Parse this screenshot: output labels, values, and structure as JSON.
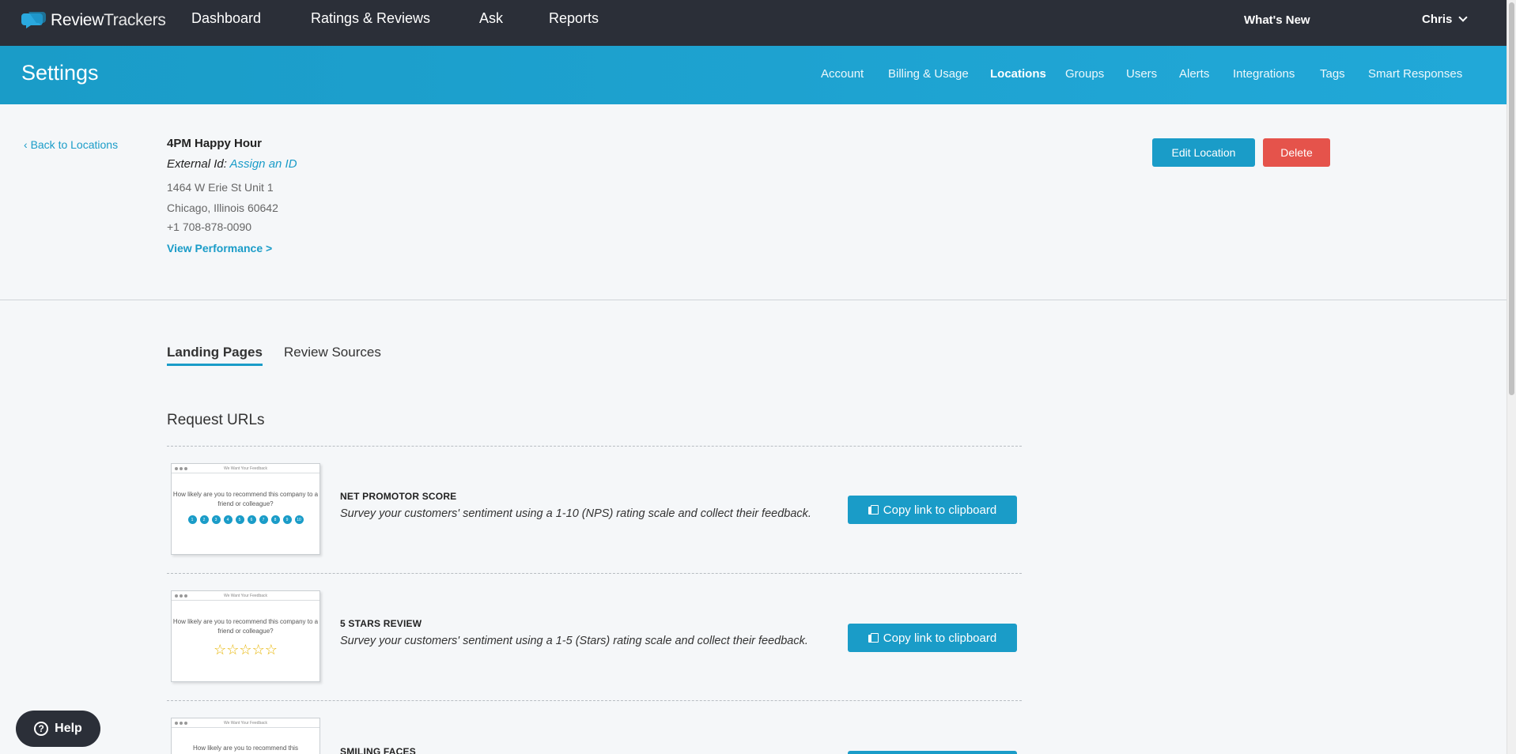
{
  "topbar": {
    "logo_text_a": "Review",
    "logo_text_b": "Trackers",
    "nav": [
      "Dashboard",
      "Ratings & Reviews",
      "Ask",
      "Reports"
    ],
    "whats_new": "What's New",
    "user": "Chris"
  },
  "settings": {
    "title": "Settings",
    "tabs": [
      "Account",
      "Billing & Usage",
      "Locations",
      "Groups",
      "Users",
      "Alerts",
      "Integrations",
      "Tags",
      "Smart Responses"
    ],
    "active_tab": "Locations"
  },
  "location": {
    "back_label": "Back to Locations",
    "name": "4PM Happy Hour",
    "external_id_label": "External Id:",
    "external_id_link": "Assign an ID",
    "address_line1": "1464 W Erie St Unit 1",
    "address_line2": "Chicago, Illinois 60642",
    "phone": "+1 708-878-0090",
    "view_performance": "View Performance >",
    "edit_label": "Edit Location",
    "delete_label": "Delete"
  },
  "content_tabs": {
    "landing": "Landing Pages",
    "sources": "Review Sources"
  },
  "section_title": "Request URLs",
  "cards": [
    {
      "thumb_title": "We Want Your Feedback",
      "thumb_question": "How likely are you to recommend this company to a friend or colleague?",
      "title": "NET PROMOTOR SCORE",
      "desc": "Survey your customers' sentiment using a 1-10 (NPS) rating scale and collect their feedback.",
      "button": "Copy link to clipboard",
      "nps": [
        "1",
        "2",
        "3",
        "4",
        "5",
        "6",
        "7",
        "8",
        "9",
        "10"
      ]
    },
    {
      "thumb_title": "We Want Your Feedback",
      "thumb_question": "How likely are you to recommend this company to a friend or colleague?",
      "title": "5 STARS REVIEW",
      "desc": "Survey your customers' sentiment using a 1-5 (Stars) rating scale and collect their feedback.",
      "button": "Copy link to clipboard",
      "stars": "☆☆☆☆☆"
    },
    {
      "thumb_title": "We Want Your Feedback",
      "thumb_question": "How likely are you to recommend this",
      "title": "SMILING FACES"
    }
  ],
  "help": "Help",
  "colors": {
    "accent": "#1a9cc8",
    "danger": "#e5534b",
    "topbar": "#2b2f38"
  }
}
